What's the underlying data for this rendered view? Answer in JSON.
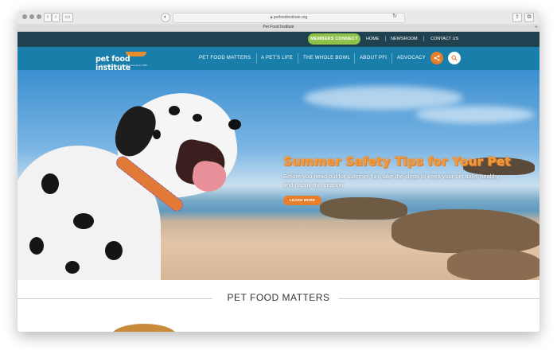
{
  "browser": {
    "url": "petfoodinstitute.org",
    "tab_title": "Pet Food Institute"
  },
  "topbar": {
    "members_button": "MEMBERS CONNECT",
    "links": [
      "HOME",
      "NEWSROOM",
      "CONTACT US"
    ]
  },
  "logo": {
    "name": "pet food institute",
    "tagline": "Promoting long and healthy lives since 1958"
  },
  "mainnav": {
    "items": [
      "PET FOOD MATTERS",
      "A PET'S LIFE",
      "THE WHOLE BOWL",
      "ABOUT PFI",
      "ADVOCACY"
    ],
    "share_icon": "share-icon",
    "search_icon": "search-icon"
  },
  "hero": {
    "title": "Summer Safety Tips for Your Pet",
    "subtitle": "Before you head out for summer fun, take the steps to keep your pet safe, healthy and happy this season.",
    "cta": "LEARN MORE"
  },
  "section": {
    "title": "PET FOOD MATTERS"
  },
  "colors": {
    "topbar": "#1f4150",
    "nav": "#1a7eab",
    "members_green": "#8fc24a",
    "accent_orange": "#e87d2a"
  }
}
